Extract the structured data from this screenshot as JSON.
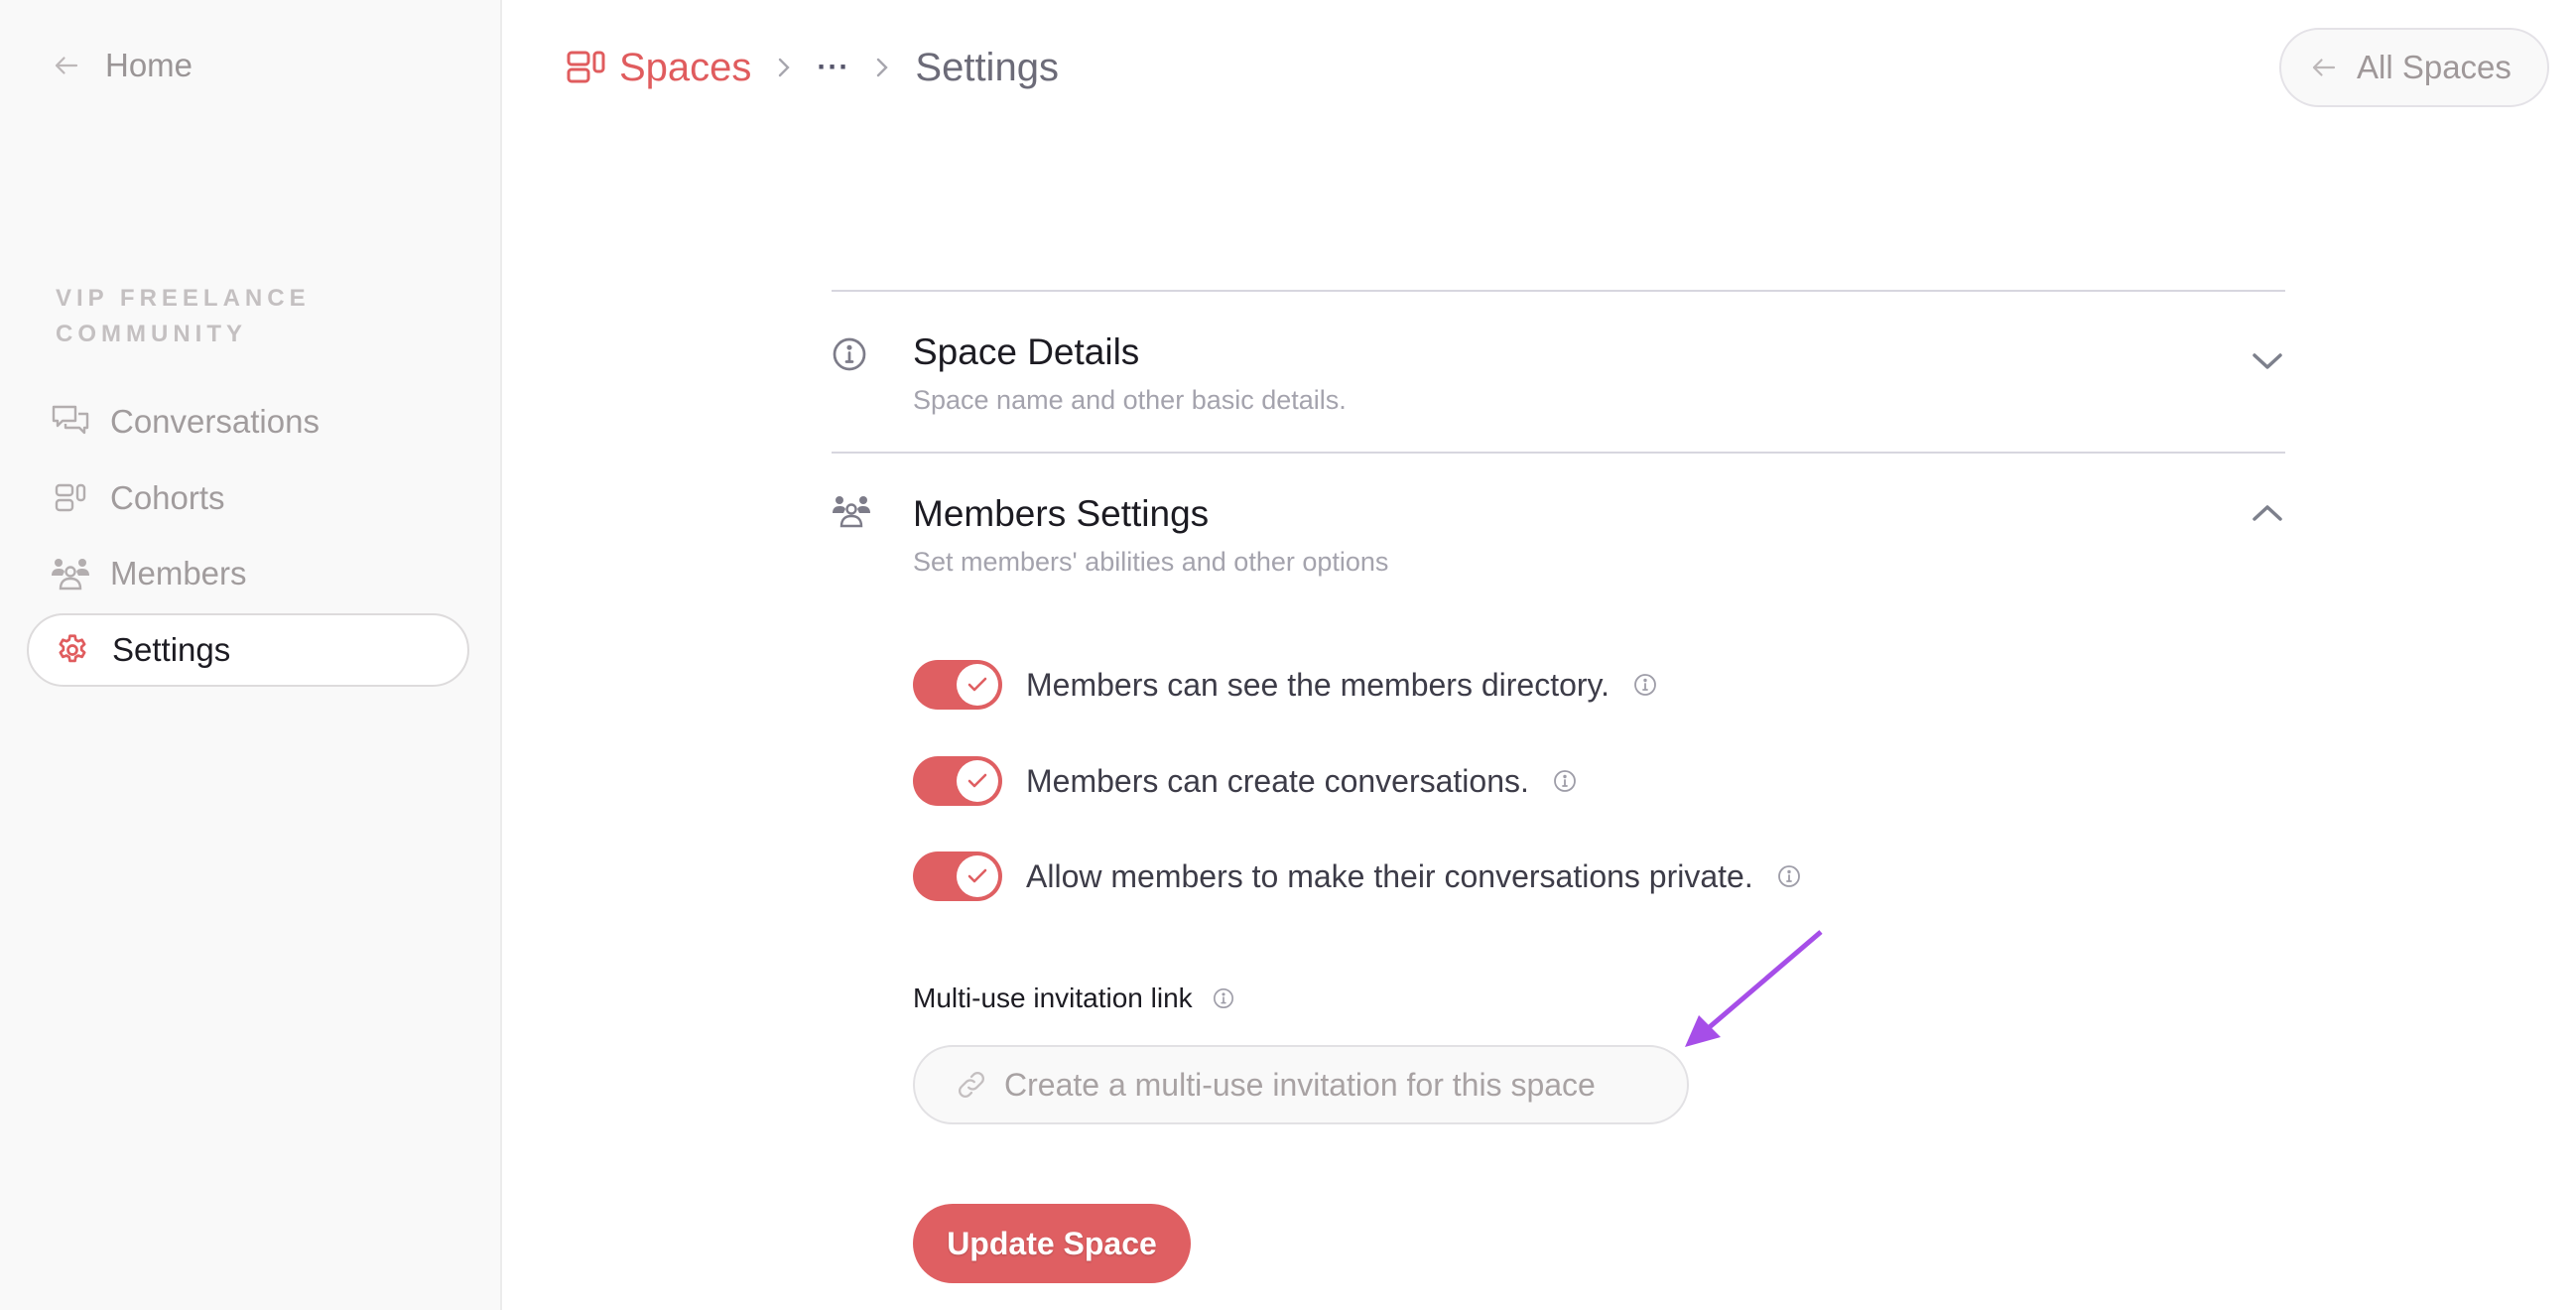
{
  "sidebar": {
    "home_label": "Home",
    "community_name": "VIP FREELANCE COMMUNITY",
    "items": [
      {
        "label": "Conversations",
        "icon": "chat-bubbles-icon",
        "active": false
      },
      {
        "label": "Cohorts",
        "icon": "cohorts-icon",
        "active": false
      },
      {
        "label": "Members",
        "icon": "members-icon",
        "active": false
      },
      {
        "label": "Settings",
        "icon": "gear-icon",
        "active": true
      }
    ]
  },
  "breadcrumb": {
    "root": "Spaces",
    "ellipsis": "···",
    "current": "Settings"
  },
  "header": {
    "all_spaces_label": "All Spaces"
  },
  "sections": {
    "space_details": {
      "title": "Space Details",
      "subtitle": "Space name and other basic details.",
      "expanded": false
    },
    "members_settings": {
      "title": "Members Settings",
      "subtitle": "Set members' abilities and other options",
      "expanded": true,
      "toggles": [
        {
          "label": "Members can see the members directory.",
          "on": true
        },
        {
          "label": "Members can create conversations.",
          "on": true
        },
        {
          "label": "Allow members to make their conversations private.",
          "on": true
        }
      ],
      "invitation": {
        "label": "Multi-use invitation link",
        "placeholder": "Create a multi-use invitation for this space"
      }
    }
  },
  "actions": {
    "update_label": "Update Space"
  },
  "colors": {
    "accent": "#df5f62",
    "annotation_arrow": "#a64ee8"
  }
}
